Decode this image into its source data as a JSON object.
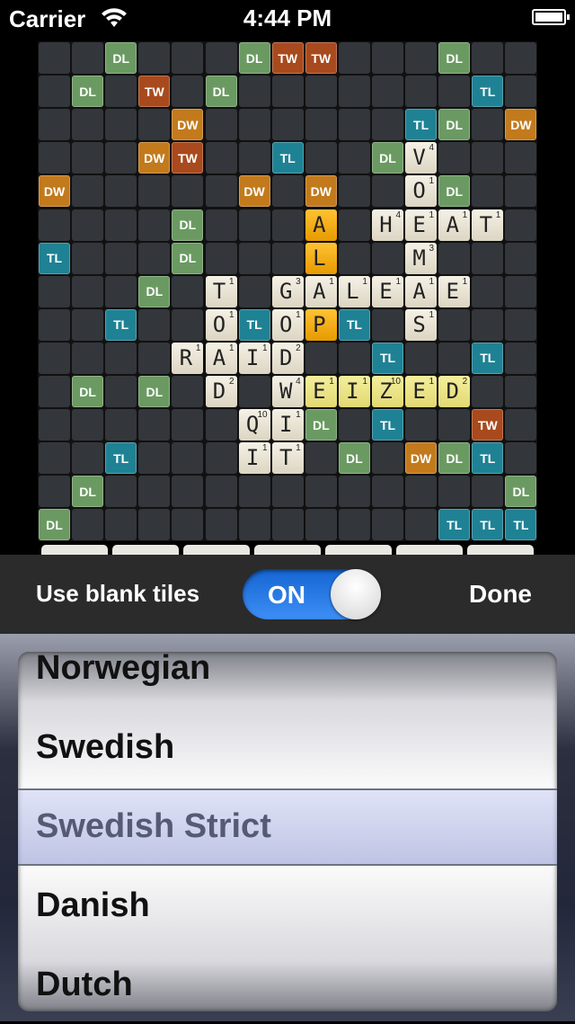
{
  "status_bar": {
    "carrier": "Carrier",
    "time": "4:44 PM"
  },
  "board": {
    "premium": [
      [
        0,
        2,
        "DL"
      ],
      [
        0,
        6,
        "DL"
      ],
      [
        0,
        7,
        "TW"
      ],
      [
        0,
        8,
        "TW"
      ],
      [
        0,
        12,
        "DL"
      ],
      [
        1,
        1,
        "DL"
      ],
      [
        1,
        3,
        "TW"
      ],
      [
        1,
        5,
        "DL"
      ],
      [
        1,
        13,
        "TL"
      ],
      [
        2,
        4,
        "DW"
      ],
      [
        2,
        11,
        "TL"
      ],
      [
        2,
        12,
        "DL"
      ],
      [
        2,
        14,
        "DW"
      ],
      [
        3,
        3,
        "DW"
      ],
      [
        3,
        4,
        "TW"
      ],
      [
        3,
        7,
        "TL"
      ],
      [
        3,
        10,
        "DL"
      ],
      [
        4,
        0,
        "DW"
      ],
      [
        4,
        6,
        "DW"
      ],
      [
        4,
        8,
        "DW"
      ],
      [
        4,
        12,
        "DL"
      ],
      [
        5,
        4,
        "DL"
      ],
      [
        6,
        0,
        "TL"
      ],
      [
        6,
        4,
        "DL"
      ],
      [
        7,
        3,
        "DL"
      ],
      [
        8,
        2,
        "TL"
      ],
      [
        8,
        6,
        "TL"
      ],
      [
        8,
        9,
        "TL"
      ],
      [
        9,
        10,
        "TL"
      ],
      [
        9,
        13,
        "TL"
      ],
      [
        10,
        1,
        "DL"
      ],
      [
        10,
        3,
        "DL"
      ],
      [
        11,
        8,
        "DL"
      ],
      [
        11,
        10,
        "TL"
      ],
      [
        11,
        13,
        "TW"
      ],
      [
        12,
        2,
        "TL"
      ],
      [
        12,
        9,
        "DL"
      ],
      [
        12,
        11,
        "DW"
      ],
      [
        12,
        12,
        "DL"
      ],
      [
        12,
        13,
        "TL"
      ],
      [
        13,
        1,
        "DL"
      ],
      [
        13,
        14,
        "DL"
      ],
      [
        14,
        0,
        "DL"
      ],
      [
        14,
        12,
        "TL"
      ],
      [
        14,
        13,
        "TL"
      ],
      [
        14,
        14,
        "TL"
      ]
    ],
    "tiles": [
      [
        3,
        11,
        "V",
        "4",
        ""
      ],
      [
        4,
        11,
        "O",
        "1",
        ""
      ],
      [
        5,
        8,
        "A",
        "",
        ""
      ],
      [
        5,
        10,
        "H",
        "4",
        ""
      ],
      [
        5,
        11,
        "E",
        "1",
        ""
      ],
      [
        5,
        12,
        "A",
        "1",
        ""
      ],
      [
        5,
        13,
        "T",
        "1",
        ""
      ],
      [
        6,
        8,
        "L",
        "",
        ""
      ],
      [
        6,
        11,
        "M",
        "3",
        ""
      ],
      [
        7,
        5,
        "T",
        "1",
        ""
      ],
      [
        7,
        7,
        "G",
        "3",
        ""
      ],
      [
        7,
        8,
        "A",
        "1",
        ""
      ],
      [
        7,
        9,
        "L",
        "1",
        ""
      ],
      [
        7,
        10,
        "E",
        "1",
        ""
      ],
      [
        7,
        11,
        "A",
        "1",
        ""
      ],
      [
        7,
        12,
        "E",
        "1",
        ""
      ],
      [
        8,
        5,
        "O",
        "1",
        ""
      ],
      [
        8,
        7,
        "O",
        "1",
        ""
      ],
      [
        8,
        8,
        "P",
        "",
        ""
      ],
      [
        8,
        11,
        "S",
        "1",
        ""
      ],
      [
        9,
        4,
        "R",
        "1",
        ""
      ],
      [
        9,
        5,
        "A",
        "1",
        ""
      ],
      [
        9,
        6,
        "I",
        "1",
        ""
      ],
      [
        9,
        7,
        "D",
        "2",
        ""
      ],
      [
        10,
        5,
        "D",
        "2",
        ""
      ],
      [
        10,
        7,
        "W",
        "4",
        ""
      ],
      [
        10,
        8,
        "E",
        "1",
        "hl"
      ],
      [
        10,
        9,
        "I",
        "1",
        "hl"
      ],
      [
        10,
        10,
        "Z",
        "10",
        "hl"
      ],
      [
        10,
        11,
        "E",
        "1",
        "hl"
      ],
      [
        10,
        12,
        "D",
        "2",
        "hl"
      ],
      [
        11,
        6,
        "Q",
        "10",
        ""
      ],
      [
        11,
        7,
        "I",
        "1",
        ""
      ],
      [
        12,
        6,
        "I",
        "1",
        ""
      ],
      [
        12,
        7,
        "T",
        "1",
        ""
      ]
    ]
  },
  "toolbar": {
    "blank_tiles_label": "Use blank tiles",
    "toggle_state": "ON",
    "done_label": "Done"
  },
  "picker": {
    "items": [
      "Norwegian",
      "Swedish",
      "Swedish Strict",
      "Danish",
      "Dutch"
    ],
    "selected": "Swedish Strict"
  }
}
